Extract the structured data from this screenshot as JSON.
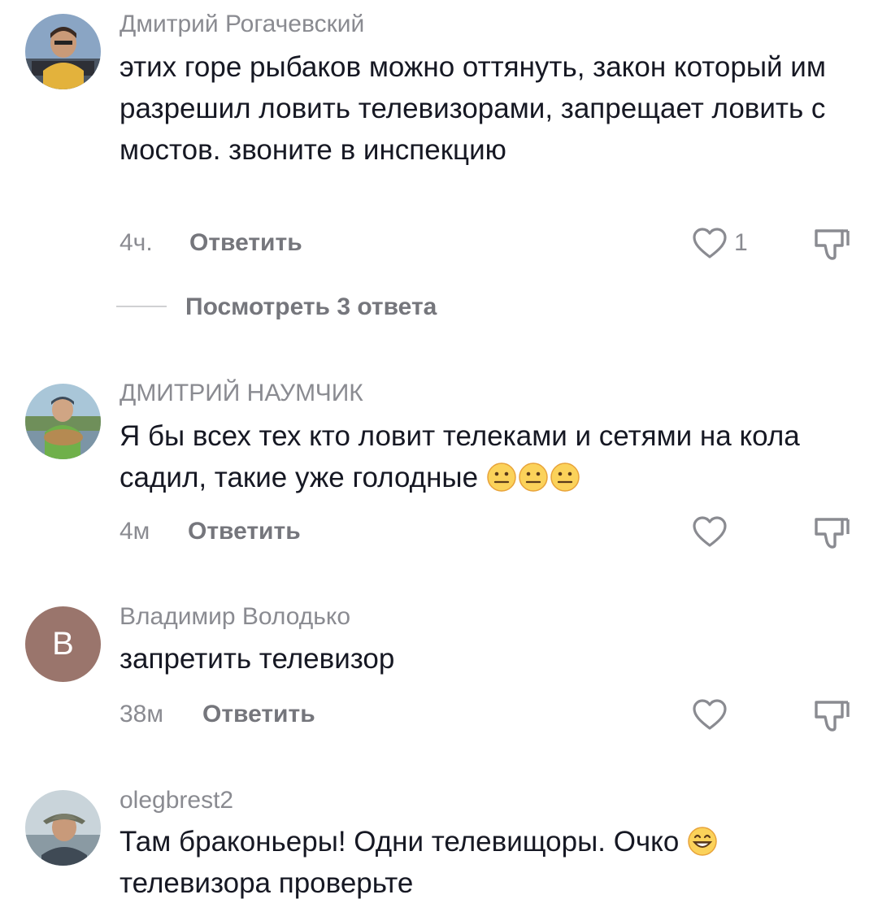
{
  "comments": [
    {
      "username": "Дмитрий Рогачевский",
      "text": "этих горе рыбаков можно оттянуть, закон который им разрешил ловить телевизорами, запрещает ловить с мостов. звоните в инспекцию",
      "time": "4ч.",
      "reply_label": "Ответить",
      "likes": "1",
      "avatar_icon": "user-photo",
      "view_replies_label": "Посмотреть 3 ответа"
    },
    {
      "username": "ДМИТРИЙ НАУМЧИК",
      "text": "Я бы всех тех кто ловит телеками и сетями на кола садил, такие уже голодные",
      "emoji": [
        "neutral-face-emoji",
        "neutral-face-emoji",
        "neutral-face-emoji"
      ],
      "time": "4м",
      "reply_label": "Ответить",
      "avatar_icon": "user-photo"
    },
    {
      "username": "Владимир Володько",
      "text": "запретить телевизор",
      "time": "38м",
      "reply_label": "Ответить",
      "avatar_letter": "B",
      "avatar_color": "#9a756c"
    },
    {
      "username": "olegbrest2",
      "text": "Там браконьеры! Одни телевищоры. Очко",
      "emoji": [
        "grinning-face-emoji"
      ],
      "text_cont": "телевизора проверьте",
      "avatar_icon": "user-photo"
    }
  ],
  "colors": {
    "text": "#161823",
    "secondary": "#8a8b91",
    "reply": "#75767c",
    "icon": "#8a8b91"
  }
}
